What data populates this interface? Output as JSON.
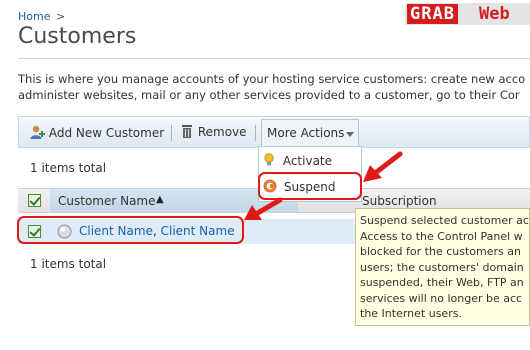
{
  "breadcrumb": {
    "home": "Home",
    "separator": ">"
  },
  "watermark": {
    "part1": "GRAB",
    "part2": "Web"
  },
  "page_title": "Customers",
  "intro_lines": [
    "This is where you manage accounts of your hosting service customers: create new acco",
    "administer websites, mail or any other services provided to a customer, go to their Cor"
  ],
  "toolbar": {
    "add_label": "Add New Customer",
    "remove_label": "Remove",
    "more_actions_label": "More Actions"
  },
  "dropdown": {
    "activate": "Activate",
    "suspend": "Suspend"
  },
  "items_total": "1 items total",
  "table": {
    "col_customer": "Customer Name",
    "sort_glyph": "▲",
    "col_subscription": "Subscription",
    "row": {
      "name": "Client Name",
      "separator": ",",
      "company": "Client Name"
    }
  },
  "tooltip_lines": [
    "Suspend selected customer ac",
    "Access to the Control Panel w",
    "blocked for the customers an",
    "users; the customers' domain",
    "suspended, their Web, FTP an",
    "services will no longer be acc",
    "the Internet users."
  ],
  "colors": {
    "highlight": "#e01818",
    "link": "#1b5fa8",
    "tooltip_bg": "#ffffe1"
  }
}
